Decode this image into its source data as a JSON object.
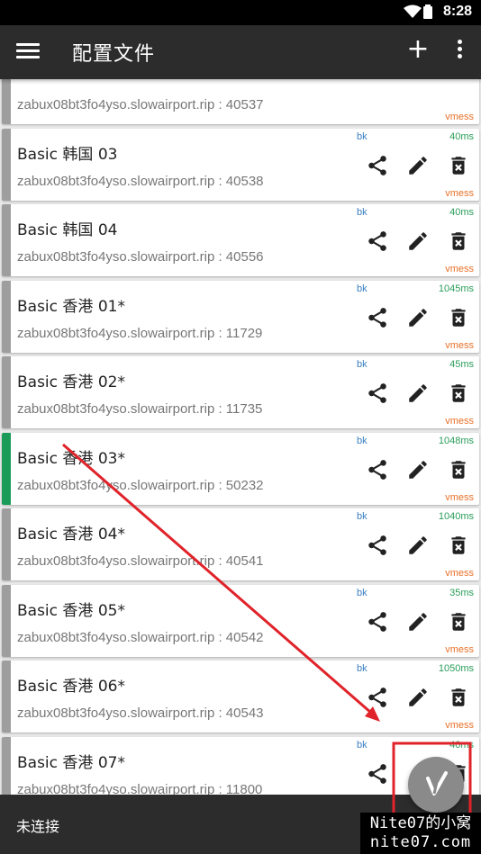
{
  "status_bar": {
    "time": "8:28"
  },
  "app_bar": {
    "title": "配置文件",
    "add_label": "+"
  },
  "profiles": [
    {
      "name": "",
      "address": "zabux08bt3fo4yso.slowairport.rip : 40537",
      "sub": "",
      "latency": "",
      "type": "vmess",
      "active": false
    },
    {
      "name": "Basic 韩国 03",
      "address": "zabux08bt3fo4yso.slowairport.rip : 40538",
      "sub": "bk",
      "latency": "40ms",
      "type": "vmess",
      "active": false
    },
    {
      "name": "Basic 韩国 04",
      "address": "zabux08bt3fo4yso.slowairport.rip : 40556",
      "sub": "bk",
      "latency": "40ms",
      "type": "vmess",
      "active": false
    },
    {
      "name": "Basic 香港 01*",
      "address": "zabux08bt3fo4yso.slowairport.rip : 11729",
      "sub": "bk",
      "latency": "1045ms",
      "type": "vmess",
      "active": false
    },
    {
      "name": "Basic 香港 02*",
      "address": "zabux08bt3fo4yso.slowairport.rip : 11735",
      "sub": "bk",
      "latency": "45ms",
      "type": "vmess",
      "active": false
    },
    {
      "name": "Basic 香港 03*",
      "address": "zabux08bt3fo4yso.slowairport.rip : 50232",
      "sub": "bk",
      "latency": "1048ms",
      "type": "vmess",
      "active": true
    },
    {
      "name": "Basic 香港 04*",
      "address": "zabux08bt3fo4yso.slowairport.rip : 40541",
      "sub": "bk",
      "latency": "1040ms",
      "type": "vmess",
      "active": false
    },
    {
      "name": "Basic 香港 05*",
      "address": "zabux08bt3fo4yso.slowairport.rip : 40542",
      "sub": "bk",
      "latency": "35ms",
      "type": "vmess",
      "active": false
    },
    {
      "name": "Basic 香港 06*",
      "address": "zabux08bt3fo4yso.slowairport.rip : 40543",
      "sub": "bk",
      "latency": "1050ms",
      "type": "vmess",
      "active": false
    },
    {
      "name": "Basic 香港 07*",
      "address": "zabux08bt3fo4yso.slowairport.rip : 11800",
      "sub": "bk",
      "latency": "40ms",
      "type": "",
      "active": false
    },
    {
      "name": "",
      "address": "",
      "sub": "",
      "latency": "",
      "type": "",
      "active": false
    }
  ],
  "bottom_bar": {
    "status": "未连接"
  },
  "watermark": {
    "line1": "Nite07的小窝",
    "line2": "nite07.com"
  },
  "colors": {
    "accent_active": "#1a9c58",
    "accent_idle": "#9e9e9e",
    "latency": "#2a9d5a",
    "sub": "#3a7fc2",
    "type": "#e8712a",
    "annotation": "#e0232a"
  }
}
